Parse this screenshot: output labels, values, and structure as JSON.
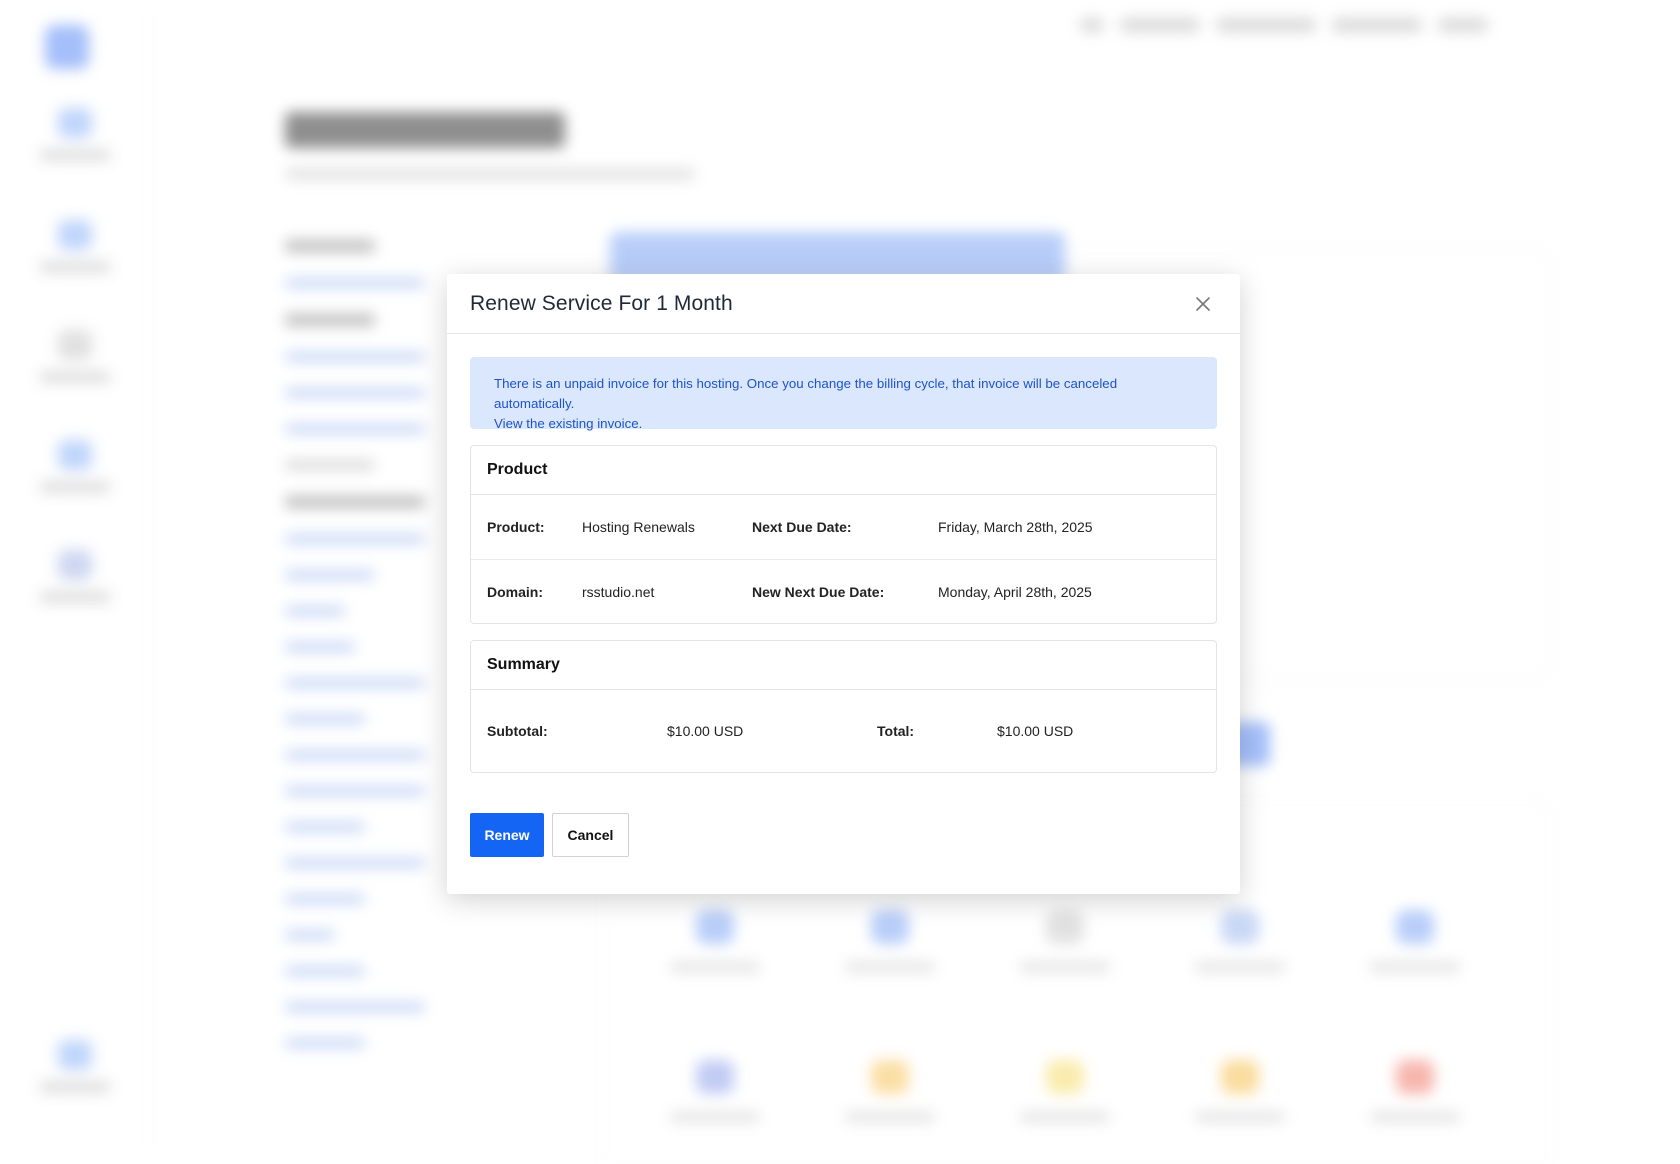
{
  "modal": {
    "title": "Renew Service For 1 Month",
    "close_icon": "close-icon",
    "alert_text": "There is an unpaid invoice for this hosting. Once you change the billing cycle, that invoice will be canceled automatically.",
    "alert_link": "View the existing invoice."
  },
  "product_panel": {
    "heading": "Product",
    "product_label": "Product:",
    "product_value": "Hosting Renewals",
    "next_due_label": "Next Due Date:",
    "next_due_value": "Friday, March 28th, 2025",
    "domain_label": "Domain:",
    "domain_value": "rsstudio.net",
    "new_next_due_label": "New Next Due Date:",
    "new_next_due_value": "Monday, April 28th, 2025"
  },
  "summary_panel": {
    "heading": "Summary",
    "subtotal_label": "Subtotal:",
    "subtotal_value": "$10.00 USD",
    "total_label": "Total:",
    "total_value": "$10.00 USD"
  },
  "actions": {
    "renew_label": "Renew",
    "cancel_label": "Cancel"
  },
  "colors": {
    "primary": "#1565f5",
    "alert_bg": "#dbe7fd",
    "alert_text": "#1d54c8"
  }
}
